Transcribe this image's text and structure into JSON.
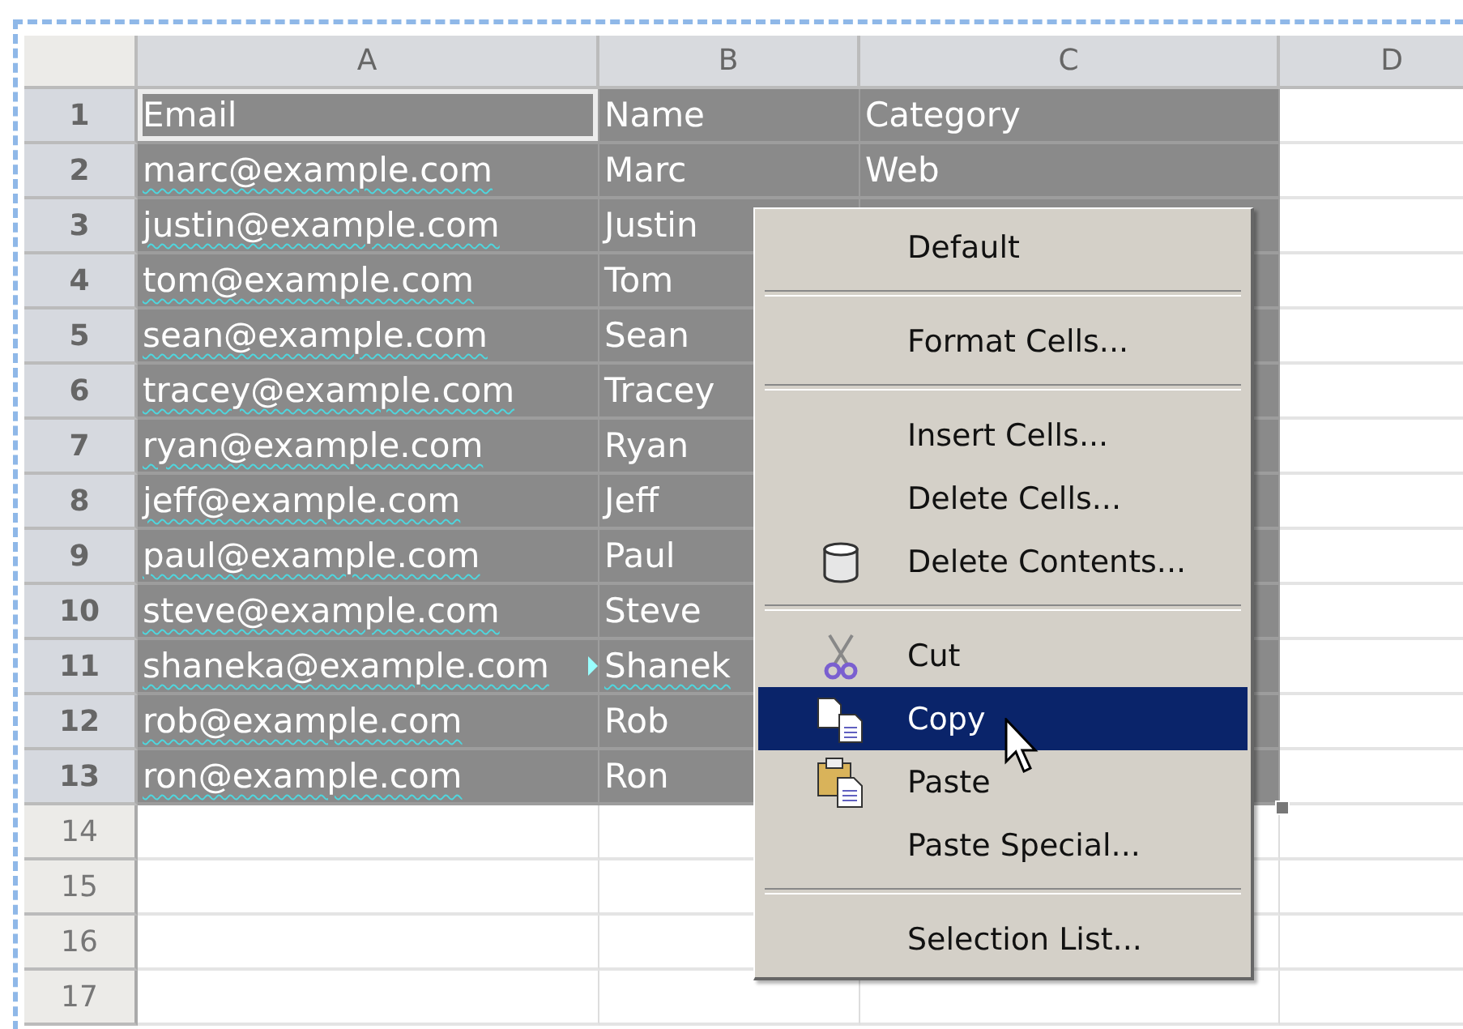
{
  "columns": [
    {
      "label": "A"
    },
    {
      "label": "B"
    },
    {
      "label": "C"
    },
    {
      "label": "D"
    }
  ],
  "rows": [
    {
      "number": "1",
      "selected": true,
      "cells": [
        {
          "text": "Email",
          "active": true,
          "misspelled": false,
          "overflow": false
        },
        {
          "text": "Name",
          "active": false,
          "misspelled": false,
          "overflow": false
        },
        {
          "text": "Category",
          "active": false,
          "misspelled": false,
          "overflow": false
        }
      ]
    },
    {
      "number": "2",
      "selected": true,
      "cells": [
        {
          "text": "marc@example.com",
          "active": false,
          "misspelled": true,
          "overflow": false
        },
        {
          "text": "Marc",
          "active": false,
          "misspelled": false,
          "overflow": false
        },
        {
          "text": "Web",
          "active": false,
          "misspelled": false,
          "overflow": false
        }
      ]
    },
    {
      "number": "3",
      "selected": true,
      "cells": [
        {
          "text": "justin@example.com",
          "active": false,
          "misspelled": true,
          "overflow": false
        },
        {
          "text": "Justin",
          "active": false,
          "misspelled": false,
          "overflow": false
        }
      ]
    },
    {
      "number": "4",
      "selected": true,
      "cells": [
        {
          "text": "tom@example.com",
          "active": false,
          "misspelled": true,
          "overflow": false
        },
        {
          "text": "Tom",
          "active": false,
          "misspelled": false,
          "overflow": false
        }
      ]
    },
    {
      "number": "5",
      "selected": true,
      "cells": [
        {
          "text": "sean@example.com",
          "active": false,
          "misspelled": true,
          "overflow": false
        },
        {
          "text": "Sean",
          "active": false,
          "misspelled": false,
          "overflow": false
        }
      ]
    },
    {
      "number": "6",
      "selected": true,
      "cells": [
        {
          "text": "tracey@example.com",
          "active": false,
          "misspelled": true,
          "overflow": false
        },
        {
          "text": "Tracey",
          "active": false,
          "misspelled": false,
          "overflow": false
        }
      ]
    },
    {
      "number": "7",
      "selected": true,
      "cells": [
        {
          "text": "ryan@example.com",
          "active": false,
          "misspelled": true,
          "overflow": false
        },
        {
          "text": "Ryan",
          "active": false,
          "misspelled": false,
          "overflow": false
        }
      ]
    },
    {
      "number": "8",
      "selected": true,
      "cells": [
        {
          "text": "jeff@example.com",
          "active": false,
          "misspelled": true,
          "overflow": false
        },
        {
          "text": "Jeff",
          "active": false,
          "misspelled": false,
          "overflow": false
        }
      ]
    },
    {
      "number": "9",
      "selected": true,
      "cells": [
        {
          "text": "paul@example.com",
          "active": false,
          "misspelled": true,
          "overflow": false
        },
        {
          "text": "Paul",
          "active": false,
          "misspelled": false,
          "overflow": false
        }
      ]
    },
    {
      "number": "10",
      "selected": true,
      "cells": [
        {
          "text": "steve@example.com",
          "active": false,
          "misspelled": true,
          "overflow": false
        },
        {
          "text": "Steve",
          "active": false,
          "misspelled": false,
          "overflow": false
        }
      ]
    },
    {
      "number": "11",
      "selected": true,
      "cells": [
        {
          "text": "shaneka@example.com",
          "active": false,
          "misspelled": true,
          "overflow": true
        },
        {
          "text": "Shanek",
          "active": false,
          "misspelled": true,
          "overflow": false
        }
      ]
    },
    {
      "number": "12",
      "selected": true,
      "cells": [
        {
          "text": "rob@example.com",
          "active": false,
          "misspelled": true,
          "overflow": false
        },
        {
          "text": "Rob",
          "active": false,
          "misspelled": false,
          "overflow": false
        }
      ]
    },
    {
      "number": "13",
      "selected": true,
      "cells": [
        {
          "text": "ron@example.com",
          "active": false,
          "misspelled": true,
          "overflow": false
        },
        {
          "text": "Ron",
          "active": false,
          "misspelled": false,
          "overflow": false
        }
      ]
    },
    {
      "number": "14",
      "selected": false,
      "cells": []
    },
    {
      "number": "15",
      "selected": false,
      "cells": []
    },
    {
      "number": "16",
      "selected": false,
      "cells": []
    },
    {
      "number": "17",
      "selected": false,
      "cells": []
    }
  ],
  "context_menu": {
    "items": [
      {
        "kind": "item",
        "label": "Default",
        "selected": false
      },
      {
        "kind": "separator"
      },
      {
        "kind": "item",
        "label": "Format Cells...",
        "selected": false
      },
      {
        "kind": "separator"
      },
      {
        "kind": "item",
        "label": "Insert Cells...",
        "selected": false
      },
      {
        "kind": "item",
        "label": "Delete Cells...",
        "selected": false
      },
      {
        "kind": "item",
        "label": "Delete Contents...",
        "selected": false
      },
      {
        "kind": "separator"
      },
      {
        "kind": "item",
        "label": "Cut",
        "selected": false
      },
      {
        "kind": "item",
        "label": "Copy",
        "selected": true
      },
      {
        "kind": "item",
        "label": "Paste",
        "selected": false
      },
      {
        "kind": "item",
        "label": "Paste Special...",
        "selected": false
      },
      {
        "kind": "separator"
      },
      {
        "kind": "item",
        "label": "Selection List...",
        "selected": false
      }
    ]
  }
}
